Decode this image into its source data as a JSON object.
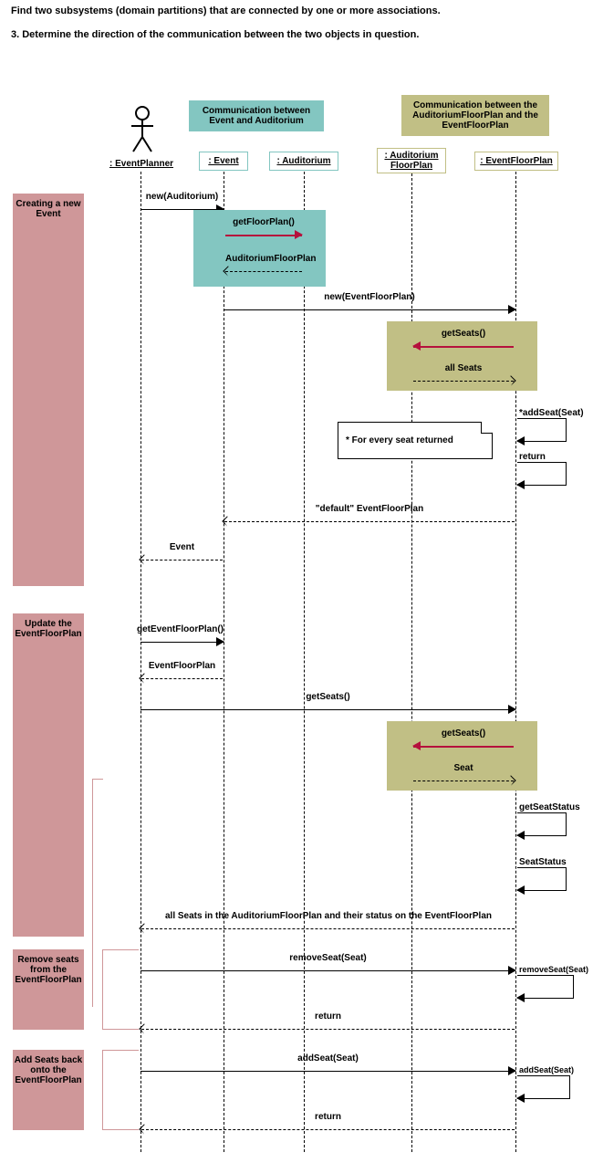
{
  "intro": {
    "line1": "Find two subsystems (domain partitions) that are connected by one or more associations.",
    "line2": "3.  Determine the direction of the communication between the two objects in question."
  },
  "comm": {
    "teal": "Communication between Event and Auditorium",
    "olive": "Communication between the AuditoriumFloorPlan and the EventFloorPlan"
  },
  "lifelines": {
    "actor": ": EventPlanner",
    "event": ": Event",
    "auditorium": ": Auditorium",
    "auditoriumFP": ": Auditorium FloorPlan",
    "eventFP": ": EventFloorPlan"
  },
  "phases": {
    "creating": "Creating a new Event",
    "update": "Update the EventFloorPlan",
    "remove": "Remove seats from the EventFloorPlan",
    "addback": "Add Seats back onto the EventFloorPlan"
  },
  "messages": {
    "newAuditorium": "new(Auditorium)",
    "getFloorPlan": "getFloorPlan()",
    "auditoriumFP": "AuditoriumFloorPlan",
    "newEFP": "new(EventFloorPlan)",
    "getSeats": "getSeats()",
    "allSeats": "all Seats",
    "addSeatStar": "*addSeat(Seat)",
    "return": "return",
    "defaultEFP": "\"default\" EventFloorPlan",
    "event": "Event",
    "getEFP": "getEventFloorPlan()",
    "efp": "EventFloorPlan",
    "seat": "Seat",
    "getSeatStatus": "getSeatStatus",
    "seatStatus": "SeatStatus",
    "allSeatsStatus": "all Seats in the AuditoriumFloorPlan and their status on the EventFloorPlan",
    "removeSeat": "removeSeat(Seat)",
    "addSeat": "addSeat(Seat)",
    "note": "* For every seat returned"
  }
}
